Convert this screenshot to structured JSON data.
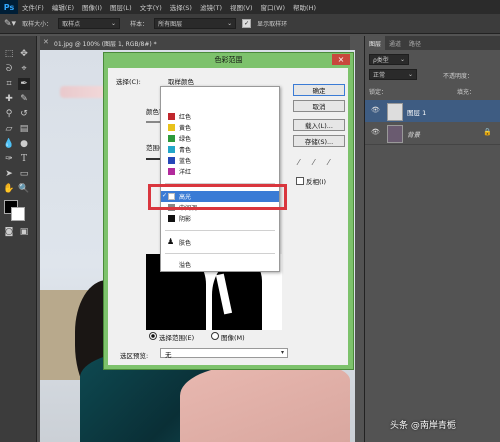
{
  "menubar": {
    "logo": "Ps",
    "items": [
      "文件(F)",
      "编辑(E)",
      "图像(I)",
      "图层(L)",
      "文字(Y)",
      "选择(S)",
      "滤镜(T)",
      "视图(V)",
      "窗口(W)",
      "帮助(H)"
    ]
  },
  "options_bar": {
    "sample_size_label": "取样大小：",
    "sample_size_value": "取样点",
    "sample_label": "样本：",
    "sample_value": "所有图层",
    "show_ring_label": "显示取样环"
  },
  "document": {
    "tab_label": "01.jpg @ 100% (图层 1, RGB/8#) *"
  },
  "panel": {
    "tabs": [
      "图层",
      "通道",
      "路径"
    ],
    "filter_label": "ρ类型",
    "blend_mode": "正常",
    "opacity_label": "不透明度：",
    "lock_label": "锁定：",
    "fill_label": "填充：",
    "layers": [
      {
        "name": "图层 1"
      },
      {
        "name": "背景"
      }
    ]
  },
  "dialog": {
    "title": "色彩范围",
    "close_label": "×",
    "select_label": "选择(C):",
    "select_value": "取样颜色",
    "color_label": "颜色容",
    "range_label": "范围(",
    "buttons": {
      "ok": "确定",
      "cancel": "取消",
      "load": "载入(L)...",
      "save": "存储(S)..."
    },
    "invert_label": "反相(I)",
    "radio_selection": "选择范围(E)",
    "radio_image": "图像(M)",
    "preview_label": "选区预览:",
    "preview_value": "无"
  },
  "dropdown": {
    "items": [
      {
        "label": "红色",
        "color": "#c0272d"
      },
      {
        "label": "黄色",
        "color": "#e8c21b"
      },
      {
        "label": "绿色",
        "color": "#2d9a3c"
      },
      {
        "label": "青色",
        "color": "#22a6c9"
      },
      {
        "label": "蓝色",
        "color": "#2547b8"
      },
      {
        "label": "洋红",
        "color": "#b22a9c"
      }
    ],
    "highlights": {
      "label": "高光",
      "color": "#ffffff",
      "checkmark": "✓"
    },
    "midtones": {
      "label": "中间调",
      "color": "#888888"
    },
    "shadows": {
      "label": "阴影",
      "color": "#111111"
    },
    "skin": {
      "label": "肤色"
    },
    "out_of_gamut": {
      "label": "溢色"
    }
  },
  "watermark": "头条 @南岸青栀"
}
